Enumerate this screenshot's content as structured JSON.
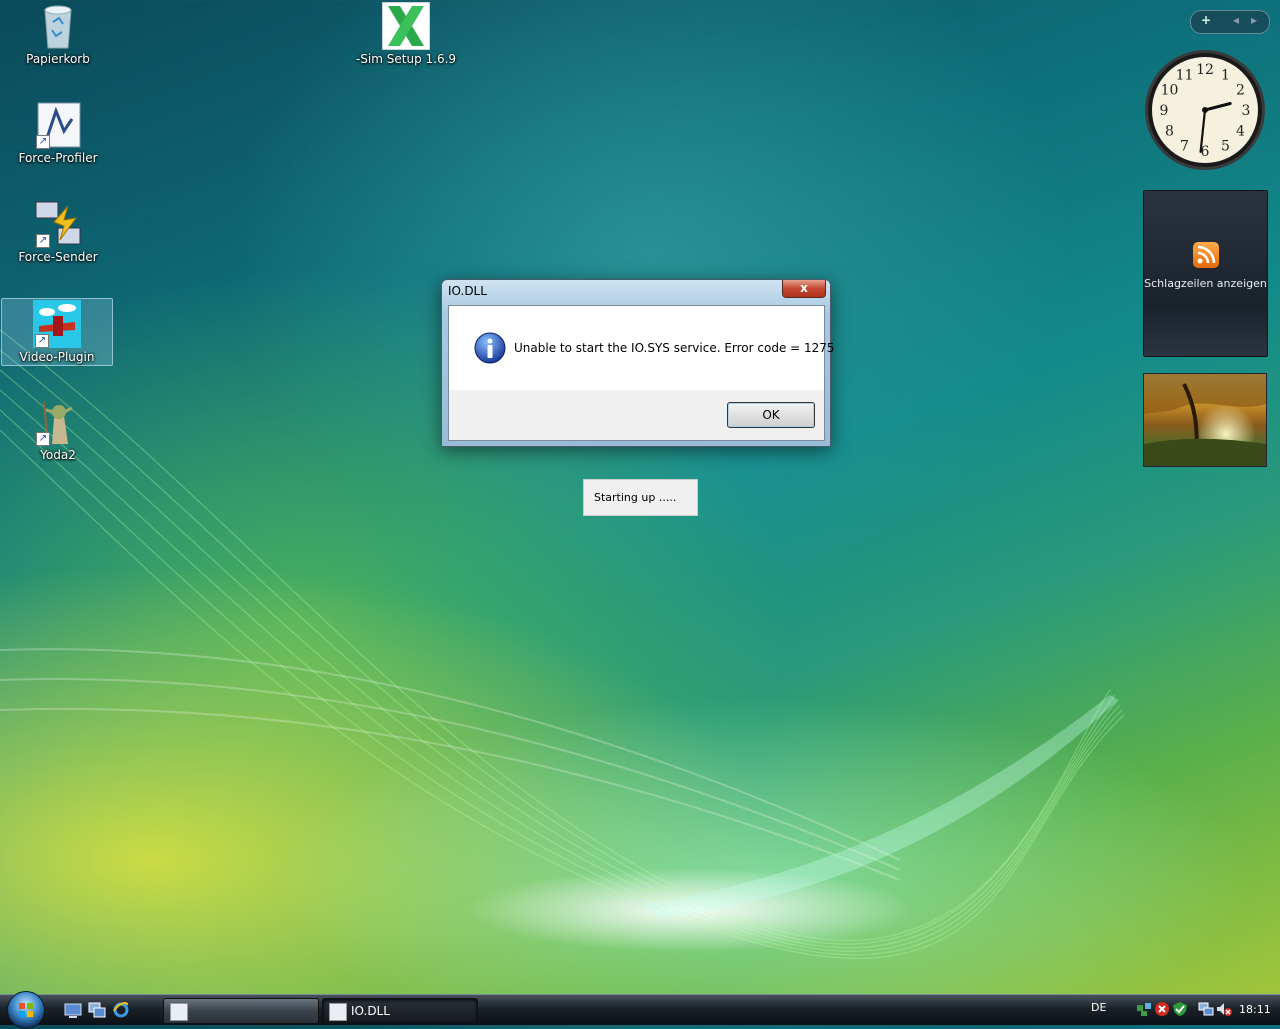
{
  "desktop": {
    "icons": [
      {
        "label": "Papierkorb",
        "icon": "recycle-bin-icon"
      },
      {
        "label": "-Sim Setup 1.6.9",
        "icon": "x-sim-icon"
      },
      {
        "label": "Force-Profiler",
        "icon": "force-profiler-icon"
      },
      {
        "label": "Force-Sender",
        "icon": "force-sender-icon"
      },
      {
        "label": "Video-Plugin",
        "icon": "video-plugin-icon",
        "selected": true
      },
      {
        "label": "Yoda2",
        "icon": "yoda-icon"
      }
    ]
  },
  "sidebar": {
    "add_label": "+",
    "prev_label": "◂",
    "next_label": "▸",
    "clock": {
      "numerals": [
        "12",
        "1",
        "2",
        "3",
        "4",
        "5",
        "6",
        "7",
        "8",
        "9",
        "10",
        "11"
      ],
      "hour": 2,
      "minute": 31
    },
    "feeds": {
      "label": "Schlagzeilen anzeigen"
    }
  },
  "dialog": {
    "title": "IO.DLL",
    "close_label": "x",
    "message": "Unable to start the IO.SYS service. Error code = 1275",
    "ok_label": "OK"
  },
  "startup": {
    "text": "Starting up ....."
  },
  "taskbar": {
    "buttons": [
      {
        "label": "",
        "active": false
      },
      {
        "label": "IO.DLL",
        "active": true
      }
    ],
    "language": "DE",
    "time": "18:11"
  },
  "colors": {
    "accent": "#3a86c8",
    "close": "#c44a30"
  }
}
